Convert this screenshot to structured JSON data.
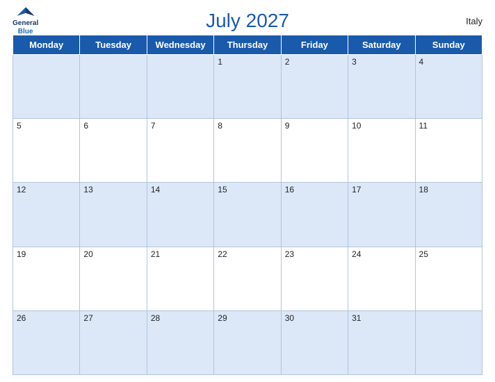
{
  "header": {
    "title": "July 2027",
    "country": "Italy",
    "logo_line1": "General",
    "logo_line2": "Blue"
  },
  "weekdays": [
    "Monday",
    "Tuesday",
    "Wednesday",
    "Thursday",
    "Friday",
    "Saturday",
    "Sunday"
  ],
  "weeks": [
    [
      null,
      null,
      null,
      1,
      2,
      3,
      4
    ],
    [
      5,
      6,
      7,
      8,
      9,
      10,
      11
    ],
    [
      12,
      13,
      14,
      15,
      16,
      17,
      18
    ],
    [
      19,
      20,
      21,
      22,
      23,
      24,
      25
    ],
    [
      26,
      27,
      28,
      29,
      30,
      31,
      null
    ]
  ]
}
